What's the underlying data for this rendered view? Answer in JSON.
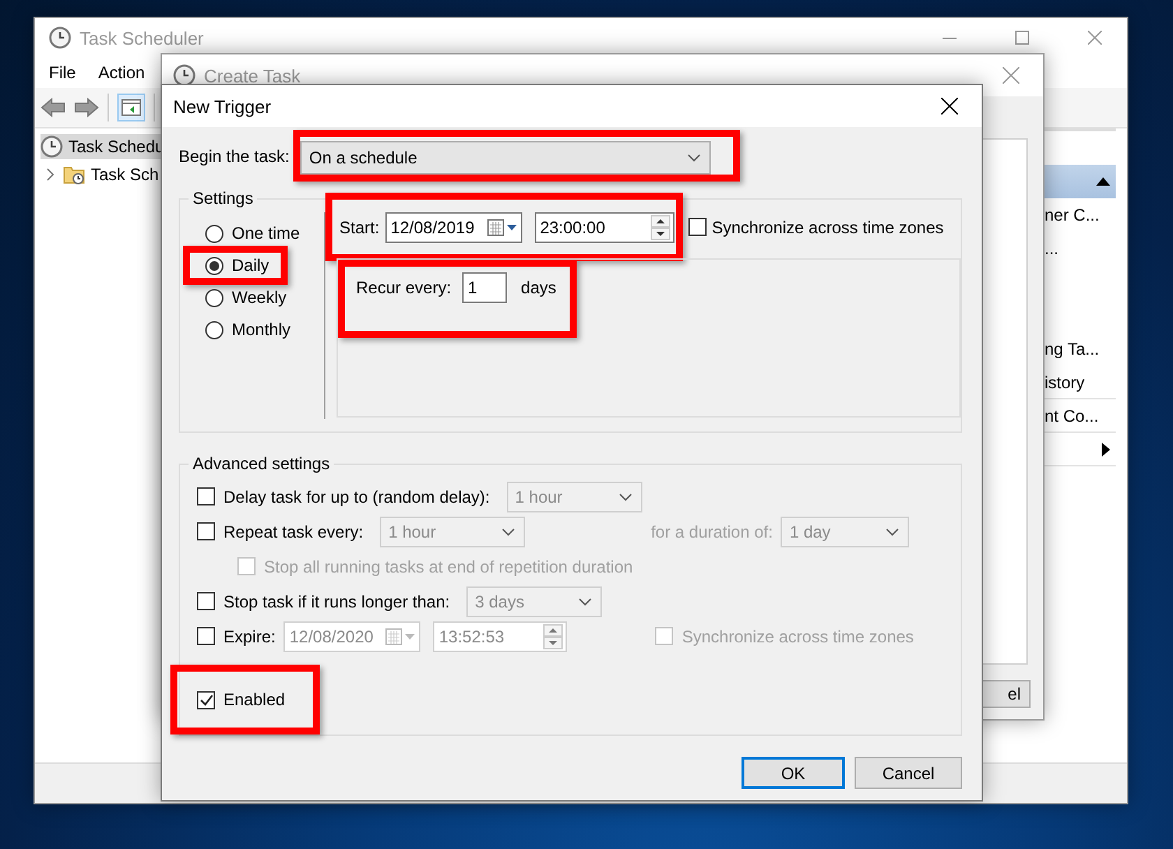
{
  "main_window": {
    "title": "Task Scheduler",
    "menu": [
      "File",
      "Action"
    ],
    "tree": [
      {
        "label": "Task Schedu",
        "children": [
          {
            "label": "Task Sch",
            "expanded": false
          }
        ]
      }
    ],
    "actions": [
      {
        "kind": "header"
      },
      {
        "kind": "item",
        "label": "ner C..."
      },
      {
        "kind": "item",
        "label": "..."
      },
      {
        "kind": "item",
        "label": "ng Ta..."
      },
      {
        "kind": "item",
        "label": "istory"
      },
      {
        "kind": "item",
        "label": "nt Co..."
      },
      {
        "kind": "submenu"
      }
    ]
  },
  "create_task": {
    "title": "Create Task",
    "button_fragment": "el"
  },
  "new_trigger": {
    "title": "New Trigger",
    "begin": {
      "label": "Begin the task:",
      "value": "On a schedule",
      "highlighted": true
    },
    "settings_title": "Settings",
    "schedule": [
      {
        "label": "One time",
        "selected": false,
        "highlighted": false
      },
      {
        "label": "Daily",
        "selected": true,
        "highlighted": true
      },
      {
        "label": "Weekly",
        "selected": false,
        "highlighted": false
      },
      {
        "label": "Monthly",
        "selected": false,
        "highlighted": false
      }
    ],
    "start": {
      "label": "Start:",
      "date": "12/08/2019",
      "time": "23:00:00",
      "highlighted": true
    },
    "sync": {
      "label": "Synchronize across time zones",
      "checked": false
    },
    "recur": {
      "label": "Recur every:",
      "value": "1",
      "unit": "days",
      "highlighted": true
    },
    "advanced_title": "Advanced settings",
    "advanced": [
      {
        "kind": "combo",
        "label": "Delay task for up to (random delay):",
        "checked": false,
        "disabled": false,
        "value": "1 hour"
      },
      {
        "kind": "repeat",
        "label": "Repeat task every:",
        "checked": false,
        "disabled": false,
        "value": "1 hour",
        "duration_label": "for a duration of:",
        "duration_value": "1 day"
      },
      {
        "kind": "sub",
        "label": "Stop all running tasks at end of repetition duration",
        "checked": false,
        "disabled": true
      },
      {
        "kind": "combo",
        "label": "Stop task if it runs longer than:",
        "checked": false,
        "disabled": false,
        "value": "3 days"
      },
      {
        "kind": "expire",
        "label": "Expire:",
        "checked": false,
        "disabled": false,
        "date": "12/08/2020",
        "time": "13:52:53",
        "sync_label": "Synchronize across time zones",
        "sync_checked": false
      }
    ],
    "enabled": {
      "label": "Enabled",
      "checked": true,
      "highlighted": true
    },
    "buttons": [
      {
        "label": "OK",
        "default": true
      },
      {
        "label": "Cancel",
        "default": false
      }
    ]
  }
}
